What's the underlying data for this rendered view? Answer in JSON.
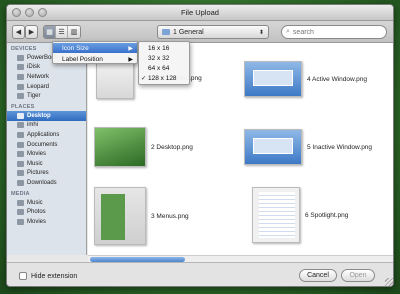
{
  "window": {
    "title": "File Upload"
  },
  "toolbar": {
    "back_icon": "back-arrow-icon",
    "forward_icon": "forward-arrow-icon",
    "view_modes": [
      "icon-view-icon",
      "list-view-icon",
      "column-view-icon"
    ],
    "location": "1 General",
    "search_placeholder": "search"
  },
  "sidebar": {
    "devices": {
      "heading": "DEVICES",
      "items": [
        "PowerBook G4",
        "iDisk",
        "Network",
        "Leopard",
        "Tiger"
      ]
    },
    "places": {
      "heading": "PLACES",
      "items": [
        "Desktop",
        "imhi",
        "Applications",
        "Documents",
        "Movies",
        "Music",
        "Pictures",
        "Downloads"
      ],
      "selected": "Desktop"
    },
    "media": {
      "heading": "MEDIA",
      "items": [
        "Music",
        "Photos",
        "Movies"
      ]
    }
  },
  "files": [
    {
      "name": "1 About This Mac.png"
    },
    {
      "name": "4 Active Window.png"
    },
    {
      "name": "2 Desktop.png"
    },
    {
      "name": "5 Inactive Window.png"
    },
    {
      "name": "3 Menus.png"
    },
    {
      "name": "6 Spotlight.png"
    }
  ],
  "view_menu": {
    "items": [
      {
        "label": "Icon Size",
        "highlighted": true
      },
      {
        "label": "Label Position",
        "highlighted": false
      }
    ]
  },
  "icon_size_menu": {
    "options": [
      "16 x 16",
      "32 x 32",
      "64 x 64",
      "128 x 128"
    ],
    "checked": "128 x 128"
  },
  "bottom": {
    "hide_extension": "Hide extension",
    "cancel": "Cancel",
    "open": "Open"
  }
}
